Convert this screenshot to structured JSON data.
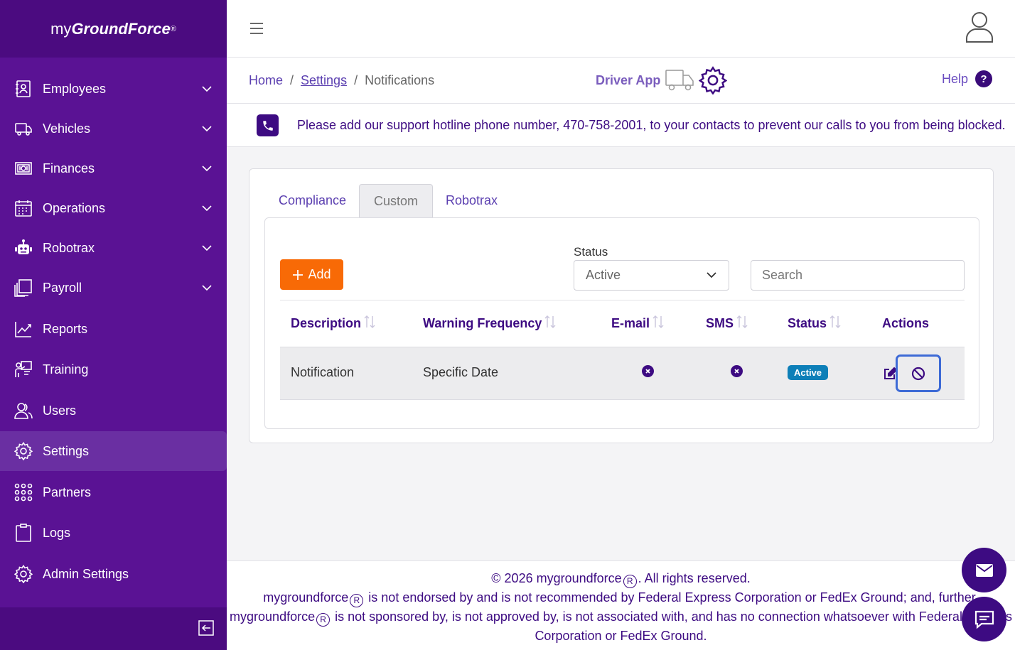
{
  "brand": {
    "prefix": "my",
    "name": "GroundForce",
    "reg": "®"
  },
  "sidebar": {
    "items": [
      {
        "label": "Employees",
        "icon": "employees-icon",
        "has_children": true
      },
      {
        "label": "Vehicles",
        "icon": "truck-icon",
        "has_children": true
      },
      {
        "label": "Finances",
        "icon": "money-icon",
        "has_children": true
      },
      {
        "label": "Operations",
        "icon": "calendar-icon",
        "has_children": true
      },
      {
        "label": "Robotrax",
        "icon": "robot-icon",
        "has_children": true
      },
      {
        "label": "Payroll",
        "icon": "copy-icon",
        "has_children": true
      },
      {
        "label": "Reports",
        "icon": "chart-line-icon",
        "has_children": false
      },
      {
        "label": "Training",
        "icon": "training-icon",
        "has_children": false
      },
      {
        "label": "Users",
        "icon": "users-icon",
        "has_children": false
      },
      {
        "label": "Settings",
        "icon": "gear-icon",
        "has_children": false,
        "active": true
      },
      {
        "label": "Partners",
        "icon": "grid-dots-icon",
        "has_children": false
      },
      {
        "label": "Logs",
        "icon": "clipboard-icon",
        "has_children": false
      },
      {
        "label": "Admin Settings",
        "icon": "gear-icon",
        "has_children": false
      }
    ]
  },
  "breadcrumb": {
    "home": "Home",
    "sep": "/",
    "settings": "Settings",
    "current": "Notifications"
  },
  "driver_app": {
    "label": "Driver App"
  },
  "help": {
    "label": "Help",
    "badge": "?"
  },
  "notice": {
    "text": "Please add our support hotline phone number, 470-758-2001, to your contacts to prevent our calls to you from being blocked."
  },
  "tabs": [
    {
      "label": "Compliance",
      "selected": false
    },
    {
      "label": "Custom",
      "selected": true
    },
    {
      "label": "Robotrax",
      "selected": false
    }
  ],
  "toolbar": {
    "add_label": "Add",
    "status_label": "Status",
    "status_value": "Active",
    "search_placeholder": "Search"
  },
  "table": {
    "columns": [
      "Description",
      "Warning Frequency",
      "E-mail",
      "SMS",
      "Status",
      "Actions"
    ],
    "rows": [
      {
        "description": "Notification",
        "frequency": "Specific Date",
        "email": false,
        "sms": false,
        "status": "Active"
      }
    ]
  },
  "footer": {
    "line1_a": "© 2026 mygroundforce",
    "line1_b": ". All rights reserved.",
    "line2_a": "mygroundforce",
    "line2_b": " is not endorsed by and is not recommended by Federal Express Corporation or FedEx Ground; and, further,",
    "line3_a": "mygroundforce",
    "line3_b": " is not sponsored by, is not approved by, is not associated with, and has no connection whatsoever with Federal Express",
    "line4": "Corporation or FedEx Ground.",
    "reg_glyph": "R"
  },
  "colors": {
    "sidebar": "#5a1294",
    "brand_bar": "#4b0b80",
    "accent": "#3d0b82",
    "add_button": "#f86a06",
    "active_badge": "#0d7fb8"
  }
}
